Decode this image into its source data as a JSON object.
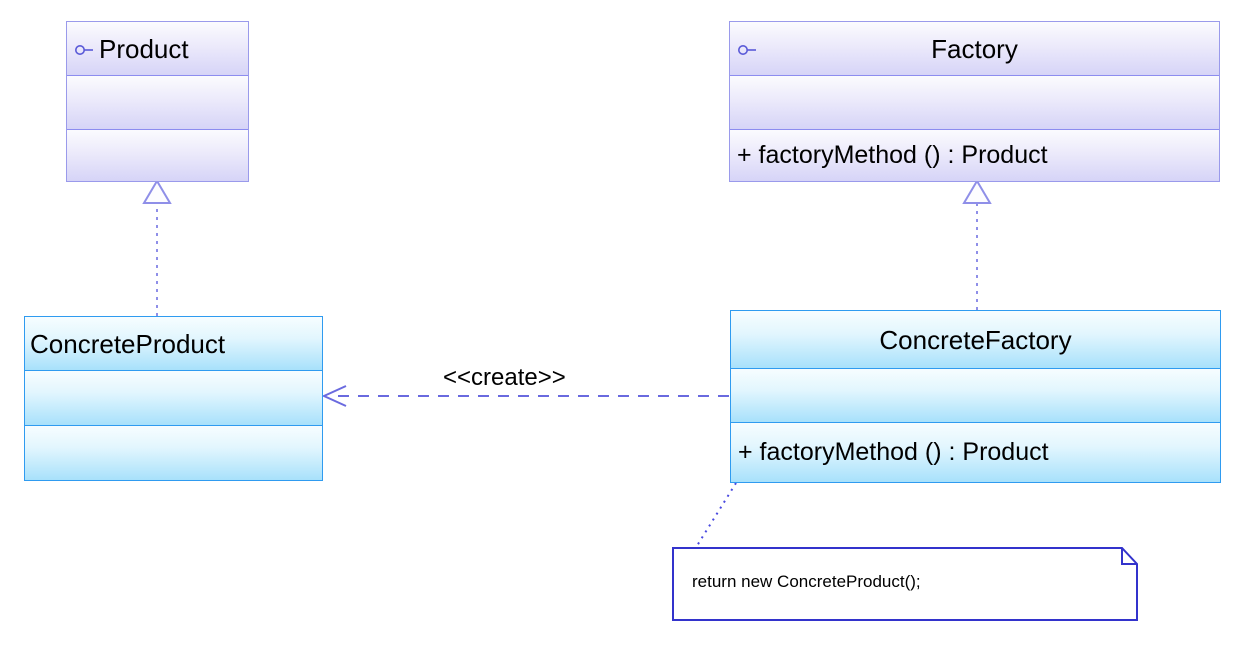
{
  "diagram": {
    "kind": "UML class diagram",
    "pattern": "Factory Method",
    "background": "#ffffff"
  },
  "palette": {
    "abstract_border": "#8c8cf0",
    "abstract_fill_top": "#fbfbfe",
    "abstract_fill_bottom": "#d6d4f7",
    "concrete_border": "#2f9bf0",
    "concrete_fill_top": "#f7fdff",
    "concrete_fill_bottom": "#a8e1fb",
    "connector": "#6a6adf",
    "note_border": "#3333cc",
    "note_fill": "#ffffff",
    "text": "#000000"
  },
  "classes": [
    {
      "id": "product",
      "name": "Product",
      "icon": "interface-lollipop-icon",
      "title_align": "left",
      "style": "abstract",
      "attributes": [],
      "operations": []
    },
    {
      "id": "factory",
      "name": "Factory",
      "icon": "interface-lollipop-icon",
      "title_align": "center",
      "style": "abstract",
      "attributes": [],
      "operations": [
        {
          "visibility": "+",
          "signature": "+ factoryMethod () : Product"
        }
      ]
    },
    {
      "id": "concrete-product",
      "name": "ConcreteProduct",
      "icon": null,
      "title_align": "left",
      "style": "concrete",
      "attributes": [],
      "operations": []
    },
    {
      "id": "concrete-factory",
      "name": "ConcreteFactory",
      "icon": null,
      "title_align": "center",
      "style": "concrete",
      "attributes": [],
      "operations": [
        {
          "visibility": "+",
          "signature": "+ factoryMethod () : Product"
        }
      ]
    }
  ],
  "relationships": [
    {
      "id": "realize-product",
      "type": "realization",
      "from": "ConcreteProduct",
      "to": "Product",
      "line": "dashed",
      "arrowhead": "hollow-triangle",
      "label": ""
    },
    {
      "id": "realize-factory",
      "type": "realization",
      "from": "ConcreteFactory",
      "to": "Factory",
      "line": "dashed",
      "arrowhead": "hollow-triangle",
      "label": ""
    },
    {
      "id": "create-dependency",
      "type": "dependency",
      "from": "ConcreteFactory",
      "to": "ConcreteProduct",
      "line": "dashed",
      "arrowhead": "open-arrow",
      "label": "<<create>>"
    },
    {
      "id": "note-anchor",
      "type": "note-link",
      "from": "ConcreteFactory",
      "to": "note-1",
      "line": "dotted",
      "arrowhead": "none",
      "label": ""
    }
  ],
  "notes": [
    {
      "id": "note-1",
      "text": "return new ConcreteProduct();",
      "attached_to": "ConcreteFactory"
    }
  ]
}
